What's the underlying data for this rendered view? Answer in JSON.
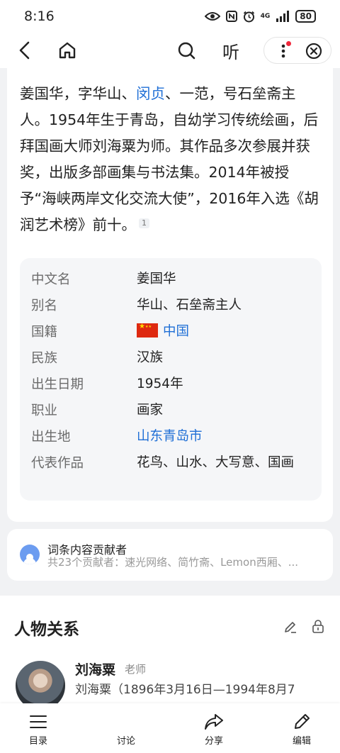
{
  "status": {
    "time": "8:16",
    "network": "4G",
    "battery": "80"
  },
  "nav": {
    "listen_label": "听"
  },
  "intro": {
    "part1": "姜国华，字华山、",
    "link": "闵贞",
    "part2": "、一范，号石垒斋主人。1954年生于青岛，自幼学习传统绘画，后拜国画大师刘海粟为师。其作品多次参展并获奖，出版多部画集与书法集。2014年被授予“海峡两岸文化交流大使”，2016年入选《胡润艺术榜》前十。",
    "cite": "1"
  },
  "info": [
    {
      "key": "中文名",
      "value": "姜国华"
    },
    {
      "key": "别名",
      "value": "华山、石垒斋主人"
    },
    {
      "key": "国籍",
      "value": "中国"
    },
    {
      "key": "民族",
      "value": "汉族"
    },
    {
      "key": "出生日期",
      "value": "1954年"
    },
    {
      "key": "职业",
      "value": "画家"
    },
    {
      "key": "出生地",
      "value": "山东青岛市"
    },
    {
      "key": "代表作品",
      "value": "花鸟、山水、大写意、国画"
    }
  ],
  "contributors": {
    "title": "词条内容贡献者",
    "subtitle": "共23个贡献者：速光网络、简竹斋、Lemon西厢、..."
  },
  "relations": {
    "title": "人物关系",
    "person": {
      "name": "刘海粟",
      "role": "老师",
      "desc": "刘海粟（1896年3月16日—1994年8月7"
    }
  },
  "tabbar": [
    {
      "label": "目录"
    },
    {
      "label": "讨论"
    },
    {
      "label": "分享"
    },
    {
      "label": "编辑"
    }
  ],
  "colors": {
    "link": "#1f6fd6",
    "accent_dot": "#f0283c"
  }
}
